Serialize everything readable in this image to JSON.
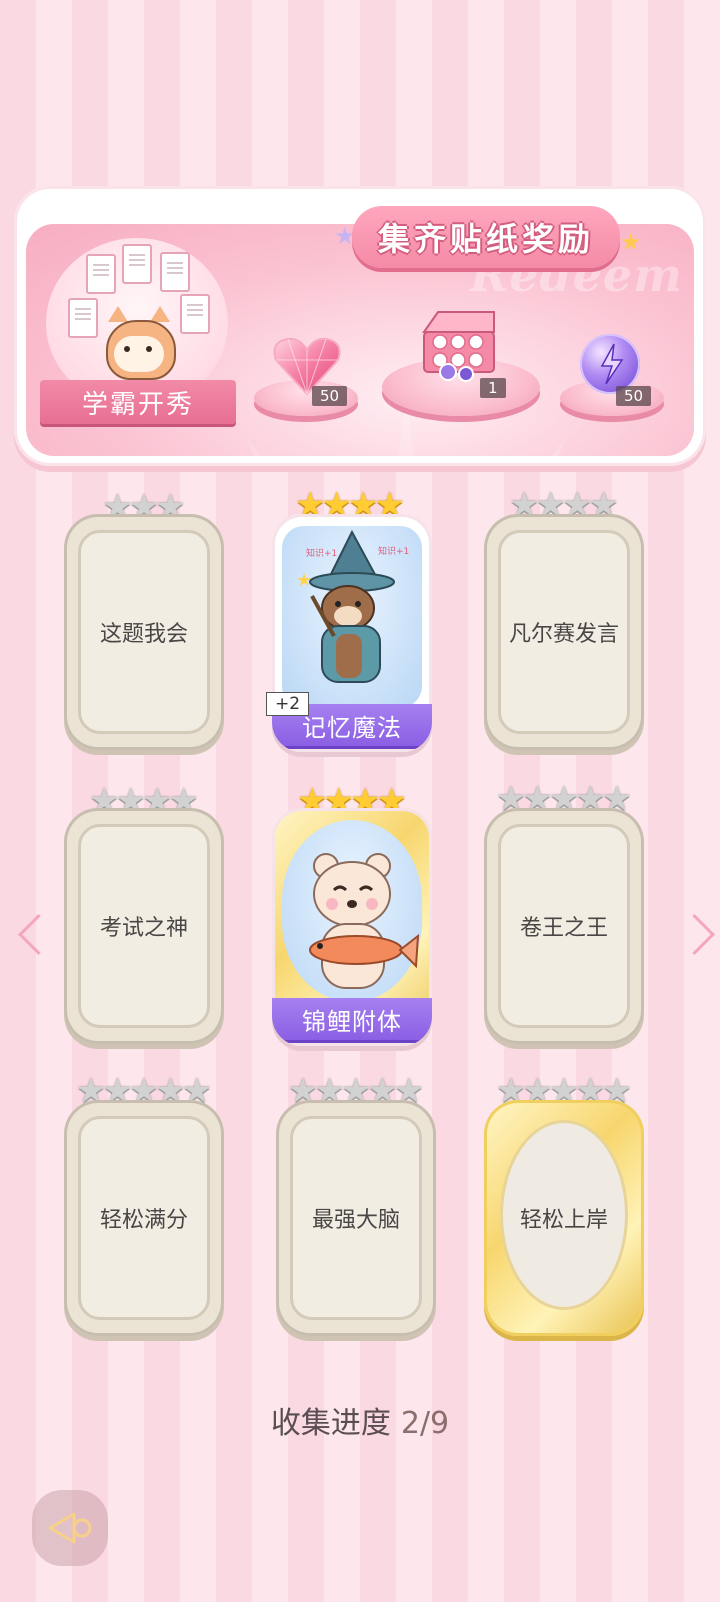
{
  "banner": {
    "title": "集齐贴纸奖励",
    "watermark": "Redeem",
    "badge_label": "学霸开秀",
    "rewards": [
      {
        "icon": "pink-diamond-heart-icon",
        "quantity": "50"
      },
      {
        "icon": "gift-box-icon",
        "quantity": "1"
      },
      {
        "icon": "lightning-orb-icon",
        "quantity": "50"
      }
    ]
  },
  "cards": [
    {
      "label": "这题我会",
      "stars": 3,
      "star_color": "silver",
      "collected": false
    },
    {
      "label": "记忆魔法",
      "stars": 4,
      "star_color": "gold",
      "collected": true,
      "extra": "+2"
    },
    {
      "label": "凡尔赛发言",
      "stars": 4,
      "star_color": "silver",
      "collected": false
    },
    {
      "label": "考试之神",
      "stars": 4,
      "star_color": "silver",
      "collected": false
    },
    {
      "label": "锦鲤附体",
      "stars": 4,
      "star_color": "gold",
      "collected": true
    },
    {
      "label": "卷王之王",
      "stars": 5,
      "star_color": "silver",
      "collected": false
    },
    {
      "label": "轻松满分",
      "stars": 5,
      "star_color": "silver",
      "collected": false
    },
    {
      "label": "最强大脑",
      "stars": 5,
      "star_color": "silver",
      "collected": false
    },
    {
      "label": "轻松上岸",
      "stars": 5,
      "star_color": "silver",
      "collected": false
    }
  ],
  "progress": {
    "label": "收集进度",
    "value": "2/9"
  },
  "colors": {
    "accent_pink": "#f48aa6",
    "banner_purple": "#8b5fe4",
    "gold": "#ffcc33"
  }
}
